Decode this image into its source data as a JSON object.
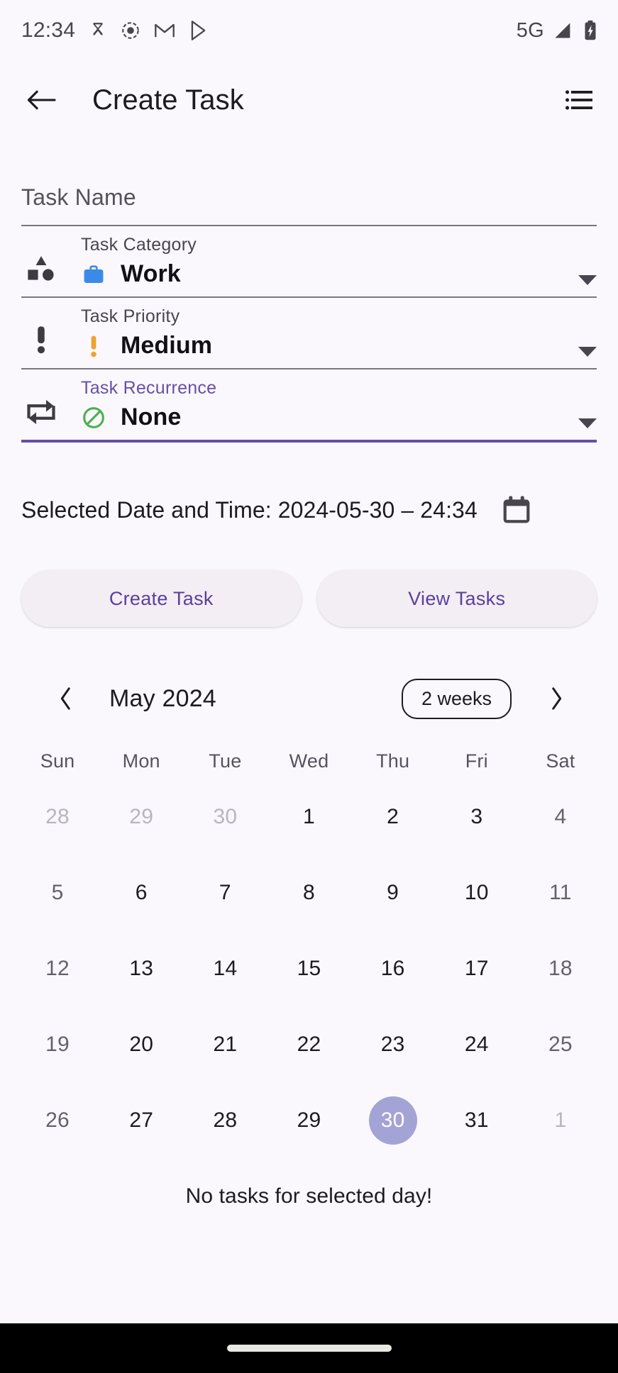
{
  "status_bar": {
    "time": "12:34",
    "network": "5G",
    "icons": [
      "hourglass-icon",
      "screen-record-icon",
      "gmail-icon",
      "play-store-icon"
    ],
    "right_icons": [
      "signal-icon",
      "battery-charging-icon"
    ]
  },
  "app_bar": {
    "title": "Create Task",
    "back_icon": "arrow-left-icon",
    "menu_icon": "hamburger-menu-icon"
  },
  "form": {
    "task_name": {
      "placeholder": "Task Name",
      "value": ""
    },
    "fields": [
      {
        "label": "Task Category",
        "value": "Work",
        "emoji": "💼",
        "lead_icon": "shapes-icon",
        "focused": false
      },
      {
        "label": "Task Priority",
        "value": "Medium",
        "emoji": "❗",
        "lead_icon": "exclamation-icon",
        "focused": false
      },
      {
        "label": "Task Recurrence",
        "value": "None",
        "emoji": "🚫",
        "lead_icon": "repeat-icon",
        "focused": true
      }
    ]
  },
  "datetime": {
    "label": "Selected Date and Time: 2024-05-30 – 24:34",
    "date": "2024-05-30",
    "time": "24:34",
    "icon": "calendar-icon"
  },
  "actions": {
    "create_label": "Create Task",
    "view_label": "View Tasks"
  },
  "calendar": {
    "month_label": "May 2024",
    "range_chip": "2 weeks",
    "prev_icon": "chevron-left-icon",
    "next_icon": "chevron-right-icon",
    "weekdays": [
      "Sun",
      "Mon",
      "Tue",
      "Wed",
      "Thu",
      "Fri",
      "Sat"
    ],
    "selected_day": 30,
    "weeks": [
      [
        {
          "n": "28",
          "other": true
        },
        {
          "n": "29",
          "other": true
        },
        {
          "n": "30",
          "other": true
        },
        {
          "n": "1",
          "other": false
        },
        {
          "n": "2",
          "other": false
        },
        {
          "n": "3",
          "other": false
        },
        {
          "n": "4",
          "other": false
        }
      ],
      [
        {
          "n": "5",
          "other": false
        },
        {
          "n": "6",
          "other": false
        },
        {
          "n": "7",
          "other": false
        },
        {
          "n": "8",
          "other": false
        },
        {
          "n": "9",
          "other": false
        },
        {
          "n": "10",
          "other": false
        },
        {
          "n": "11",
          "other": false
        }
      ],
      [
        {
          "n": "12",
          "other": false
        },
        {
          "n": "13",
          "other": false
        },
        {
          "n": "14",
          "other": false
        },
        {
          "n": "15",
          "other": false
        },
        {
          "n": "16",
          "other": false
        },
        {
          "n": "17",
          "other": false
        },
        {
          "n": "18",
          "other": false
        }
      ],
      [
        {
          "n": "19",
          "other": false
        },
        {
          "n": "20",
          "other": false
        },
        {
          "n": "21",
          "other": false
        },
        {
          "n": "22",
          "other": false
        },
        {
          "n": "23",
          "other": false
        },
        {
          "n": "24",
          "other": false
        },
        {
          "n": "25",
          "other": false
        }
      ],
      [
        {
          "n": "26",
          "other": false
        },
        {
          "n": "27",
          "other": false
        },
        {
          "n": "28",
          "other": false
        },
        {
          "n": "29",
          "other": false
        },
        {
          "n": "30",
          "other": false,
          "selected": true
        },
        {
          "n": "31",
          "other": false
        },
        {
          "n": "1",
          "other": true
        }
      ]
    ]
  },
  "empty_state": {
    "message": "No tasks for selected day!"
  },
  "colors": {
    "background": "#fbf8fd",
    "accent": "#6750a4",
    "selected_day_bg": "#a3a3d5",
    "button_bg": "#f2eef4",
    "button_text": "#5a409c",
    "divider": "#79747e"
  },
  "nav_bar": {
    "handle": "home-handle"
  }
}
